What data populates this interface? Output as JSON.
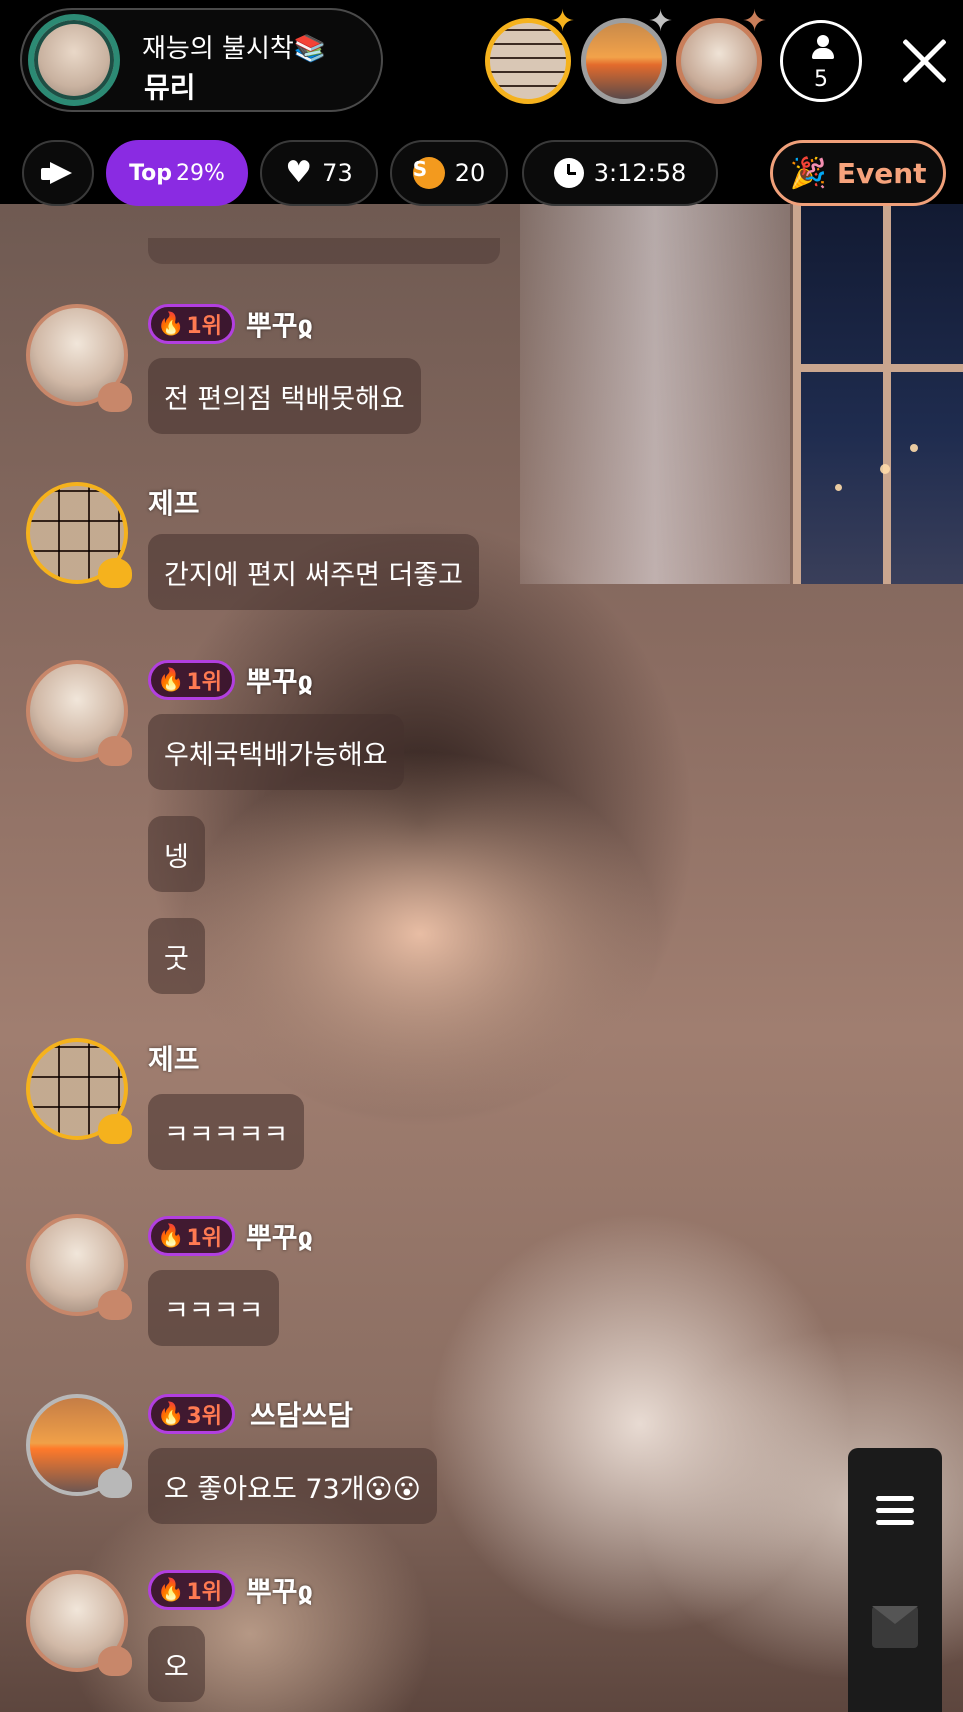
{
  "header": {
    "host_title": "재능의 불시착📚",
    "host_name": "뮤리",
    "viewer_count": "5"
  },
  "stats": {
    "top_label": "Top",
    "top_value": "29%",
    "likes": "73",
    "coin_symbol": "S",
    "coins": "20",
    "timer": "3:12:58",
    "event_label": "Event"
  },
  "chat": {
    "messages": [
      {
        "nick": "뿌꾸ჲ",
        "rank": "1위",
        "text": "전 편의점 택배못해요"
      },
      {
        "nick": "제프",
        "rank": "",
        "text": "간지에 편지 써주면 더좋고"
      },
      {
        "nick": "뿌꾸ჲ",
        "rank": "1위",
        "text": "우체국택배가능해요"
      },
      {
        "nick": "",
        "rank": "",
        "text": "넹"
      },
      {
        "nick": "",
        "rank": "",
        "text": "굿"
      },
      {
        "nick": "제프",
        "rank": "",
        "text": "ㅋㅋㅋㅋㅋ"
      },
      {
        "nick": "뿌꾸ჲ",
        "rank": "1위",
        "text": "ㅋㅋㅋㅋ"
      },
      {
        "nick": "쓰담쓰담",
        "rank": "3위",
        "text": "오 좋아요도 73개😮😮"
      },
      {
        "nick": "뿌꾸ჲ",
        "rank": "1위",
        "text": "오"
      }
    ]
  },
  "colors": {
    "accent_purple": "#8a2be2",
    "event_orange": "#f6a37c",
    "rank_border": "#b23fe0"
  },
  "icons": [
    "megaphone-icon",
    "heart-icon",
    "coin-icon",
    "clock-icon",
    "party-popper-icon",
    "person-icon",
    "close-icon",
    "fire-icon",
    "menu-icon",
    "envelope-icon"
  ]
}
